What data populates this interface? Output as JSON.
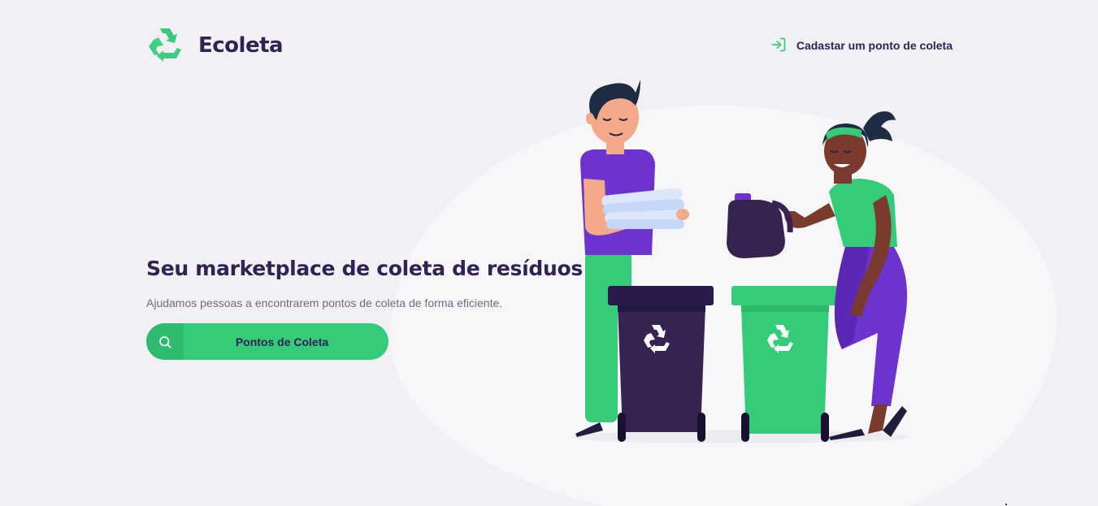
{
  "header": {
    "brand_name": "Ecoleta",
    "register_link_label": "Cadastar um ponto de coleta"
  },
  "hero": {
    "title": "Seu marketplace de coleta de resíduos",
    "description": "Ajudamos pessoas a encontrarem pontos de coleta de forma eficiente.",
    "cta_label": "Pontos de Coleta"
  },
  "colors": {
    "primary": "#34cb79",
    "title": "#322153",
    "text": "#6c6c80",
    "background": "#f0f0f5",
    "accent_purple": "#6c33ce"
  },
  "icons": {
    "logo": "recycle-icon",
    "register": "log-in-icon",
    "cta": "search-icon"
  }
}
